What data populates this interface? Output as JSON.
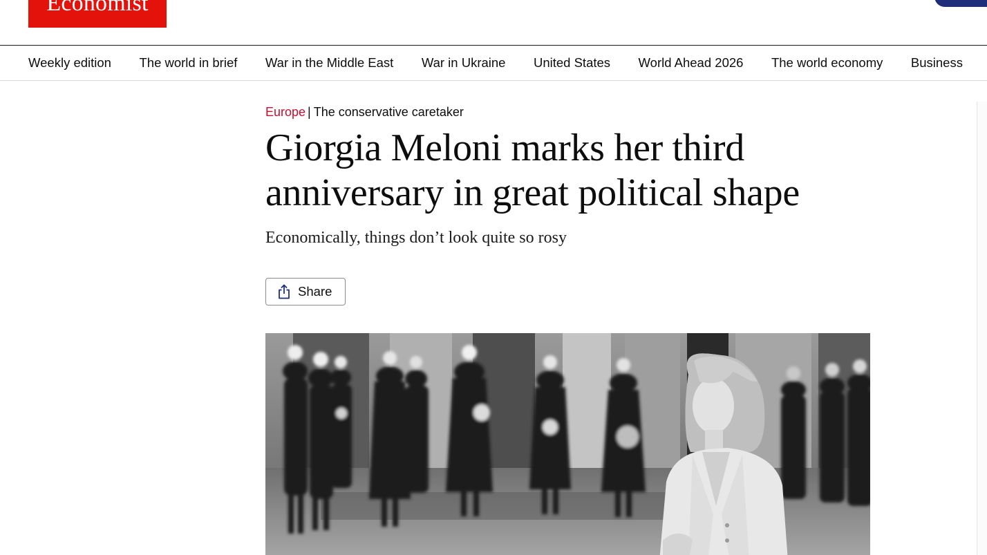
{
  "masthead": {
    "logo_text": "Economist",
    "brand_color": "#e3120b"
  },
  "nav": {
    "items": [
      "Weekly edition",
      "The world in brief",
      "War in the Middle East",
      "War in Ukraine",
      "United States",
      "World Ahead 2026",
      "The world economy",
      "Business"
    ]
  },
  "article": {
    "section": "Europe",
    "separator": "|",
    "flytitle": "The conservative caretaker",
    "headline": "Giorgia Meloni marks her third anniversary in great political shape",
    "standfirst": "Economically, things don’t look quite so rosy",
    "share_label": "Share",
    "section_color": "#c8102e"
  },
  "hero_image": {
    "icon": "photo-black-and-white-ceremonial-guard"
  }
}
